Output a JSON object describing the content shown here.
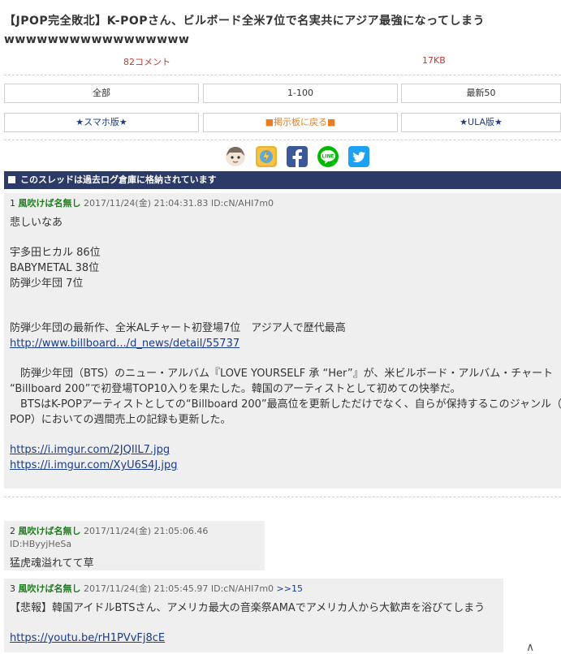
{
  "thread": {
    "title_line1": "【JPOP完全敗北】K-POPさん、ビルボード全米7位で名実共にアジア最強になってしまう",
    "title_line2": "wwwwwwwwwwwwwwwww",
    "comments": "82コメント",
    "size": "17KB"
  },
  "nav": {
    "all": "全部",
    "range": "1-100",
    "latest": "最新50",
    "smartphone": "★スマホ版★",
    "back": "■掲示板に戻る■",
    "ula": "★ULA版★"
  },
  "banner": {
    "text": "このスレッドは過去ログ倉庫に格納されています"
  },
  "share_icons": [
    "avatar-icon",
    "lightning-icon",
    "facebook-icon",
    "line-icon",
    "twitter-icon"
  ],
  "colors": {
    "banner": "#2b3a67",
    "name": "#1e7b1e",
    "link": "#1a3a8a",
    "facebook": "#3b5998",
    "line": "#00b900",
    "twitter": "#1da1f2"
  },
  "posts": [
    {
      "num": "1",
      "name": "風吹けば名無し",
      "date": "2017/11/24(金) 21:04:31.83",
      "id": "ID:cN/AHI7m0",
      "lines": {
        "l1": "悲しいなあ",
        "l2": "宇多田ヒカル 86位",
        "l3": "BABYMETAL 38位",
        "l4": "防弾少年団 7位",
        "l5": "防弾少年団の最新作、全米ALチャート初登場7位　アジア人で歴代最高",
        "link1": "http://www.billboard.../d_news/detail/55737",
        "l6": "　防弾少年団（BTS）のニュー・アルバム『LOVE YOURSELF 承 “Her”』が、米ビルボード・アルバム・チャート",
        "l7": "“Billboard 200”で初登場TOP10入りを果たした。韓国のアーティストとして初めての快挙だ。",
        "l8": "　BTSはK-POPアーティストとしての“Billboard 200”最高位を更新しただけでなく、自らが保持するこのジャンル（K-",
        "l9": "POP）においての週間売上の記録も更新した。",
        "link2": "https://i.imgur.com/2JQIlL7.jpg",
        "link3": "https://i.imgur.com/XyU6S4J.jpg"
      }
    },
    {
      "num": "2",
      "name": "風吹けば名無し",
      "date": "2017/11/24(金) 21:05:06.46",
      "id": "ID:HByyjHeSa",
      "lines": {
        "l1": "猛虎魂溢れてて草"
      }
    },
    {
      "num": "3",
      "name": "風吹けば名無し",
      "date": "2017/11/24(金) 21:05:45.97",
      "id": "ID:cN/AHI7m0",
      "ref": ">>15",
      "lines": {
        "l1": "【悲報】韓国アイドルBTSさん、アメリカ最大の音楽祭AMAでアメリカ人から大歓声を浴びてしまう",
        "link1": "https://youtu.be/rH1PVvFj8cE"
      }
    }
  ],
  "scrolltop": "∧"
}
